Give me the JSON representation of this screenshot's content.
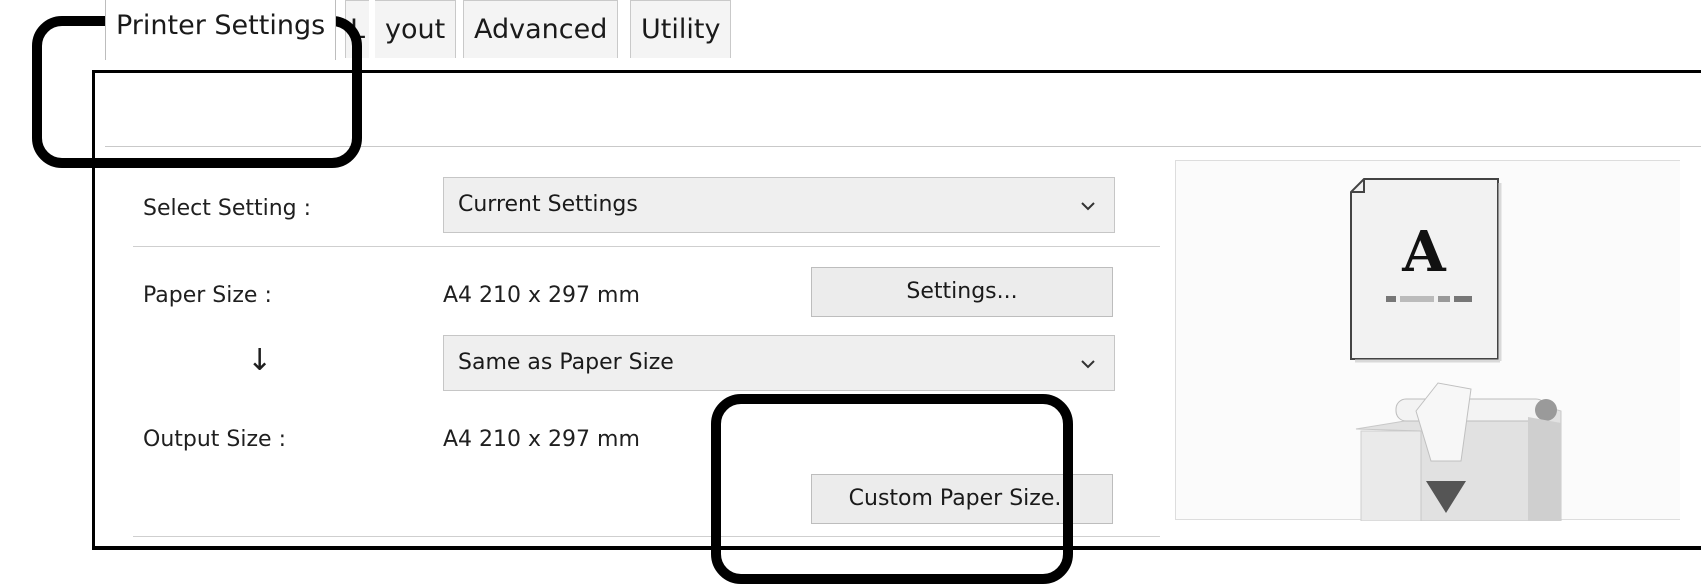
{
  "tabs": [
    {
      "label": "Printer Settings",
      "active": true
    },
    {
      "label": "L",
      "active": false
    },
    {
      "label": "yout",
      "active": false
    },
    {
      "label": "Advanced",
      "active": false
    },
    {
      "label": "Utility",
      "active": false
    }
  ],
  "select_setting": {
    "label": "Select Setting :",
    "value": "Current Settings"
  },
  "paper_size": {
    "label": "Paper Size :",
    "value": "A4 210 x 297 mm",
    "settings_button": "Settings..."
  },
  "arrow_glyph": "↓",
  "output_dropdown": {
    "value": "Same as Paper Size"
  },
  "output_size": {
    "label": "Output Size :",
    "value": "A4 210 x 297 mm"
  },
  "custom_paper_button": "Custom Paper Size...",
  "preview": {
    "paper_letter": "A"
  },
  "icons": {
    "dropdown": "chevron-down-icon",
    "paper": "paper-document-icon",
    "printer": "printer-icon"
  },
  "colors": {
    "highlight": "#000000",
    "button_face": "#ececec",
    "dropdown_face": "#efefef"
  }
}
